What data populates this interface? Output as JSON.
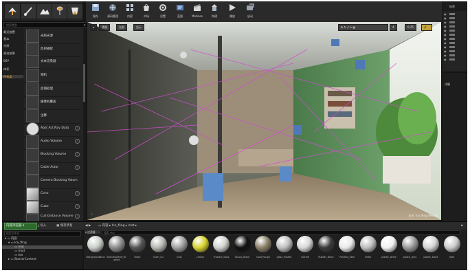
{
  "modes": [
    "Place",
    "Paint",
    "Landscape",
    "Foliage",
    "Geometry"
  ],
  "places": {
    "search_placeholder": "搜索类别",
    "categories": [
      "最近放置",
      "基本",
      "光照",
      "视觉效果",
      "BSP",
      "体积",
      "所有类"
    ],
    "selected_category": "所有类",
    "items": [
      "光照光源",
      "反射捕捉",
      "文本渲染器",
      "相机",
      "后期处理",
      "摄像机覆盖",
      "注释",
      "Abst Act Nav Data",
      "Audio Volume",
      "Blocking Volume",
      "Cable Actor",
      "Camera Blocking Volum",
      "Cone",
      "Cube",
      "Cull Distance Volume"
    ]
  },
  "toolbar": {
    "buttons": [
      "保存",
      "源码管理",
      "内容",
      "市场",
      "设置",
      "蓝图",
      "Matinee",
      "构建",
      "播放",
      "启动"
    ]
  },
  "viewport": {
    "view_mode": "透视",
    "lit_mode": "光照",
    "show_label": "显示",
    "camera_speed": "0.25",
    "grid_number": "4",
    "level_label": "关卡: Ice_fling (持久性)"
  },
  "outliner": {
    "header": "标签",
    "rows": 12
  },
  "details": {
    "tab_label": "详细"
  },
  "content_browser": {
    "tab_label": "内容浏览器",
    "import_label": "导入",
    "save_all_label": "保存所有",
    "path": [
      "内容",
      "Ice_fling",
      "mat"
    ],
    "filters_label": "过滤器",
    "search_placeholder": "搜索 Mat",
    "tree": {
      "search_placeholder": "搜索文件夹",
      "items": [
        "内容",
        "Ice_fling",
        "mat",
        "mod",
        "tex",
        "StarterContent"
      ]
    },
    "assets": [
      {
        "name": "BackgroundBlue",
        "color": "#c9cec8"
      },
      {
        "name": "StainlessSteel_Brushed",
        "color": "#8c8c8c"
      },
      {
        "name": "Black",
        "color": "#555555"
      },
      {
        "name": "Cloth_O2",
        "color": "#b8b6b0"
      },
      {
        "name": "Gray",
        "color": "#a0a0a0"
      },
      {
        "name": "Lemon",
        "color": "#d8d22e"
      },
      {
        "name": "Frosted_Glass",
        "color": "#cfd2cc"
      },
      {
        "name": "Glossy_Black",
        "color": "#101010"
      },
      {
        "name": "Gold_Rough",
        "color": "#8a8068"
      },
      {
        "name": "glass_frosted",
        "color": "#bebebe"
      },
      {
        "name": "marble",
        "color": "#d7d7d7"
      },
      {
        "name": "Rubber_Black",
        "color": "#3c3c3c"
      },
      {
        "name": "Painting_Wall",
        "color": "#e9e9e9"
      },
      {
        "name": "metal",
        "color": "#bdbdbd"
      },
      {
        "name": "plastic_white",
        "color": "#f0f0f0"
      },
      {
        "name": "plastic_gray",
        "color": "#9a9a9a"
      },
      {
        "name": "plastic_black",
        "color": "#d4d4d4"
      },
      {
        "name": "light",
        "color": "#cacaca"
      }
    ]
  }
}
